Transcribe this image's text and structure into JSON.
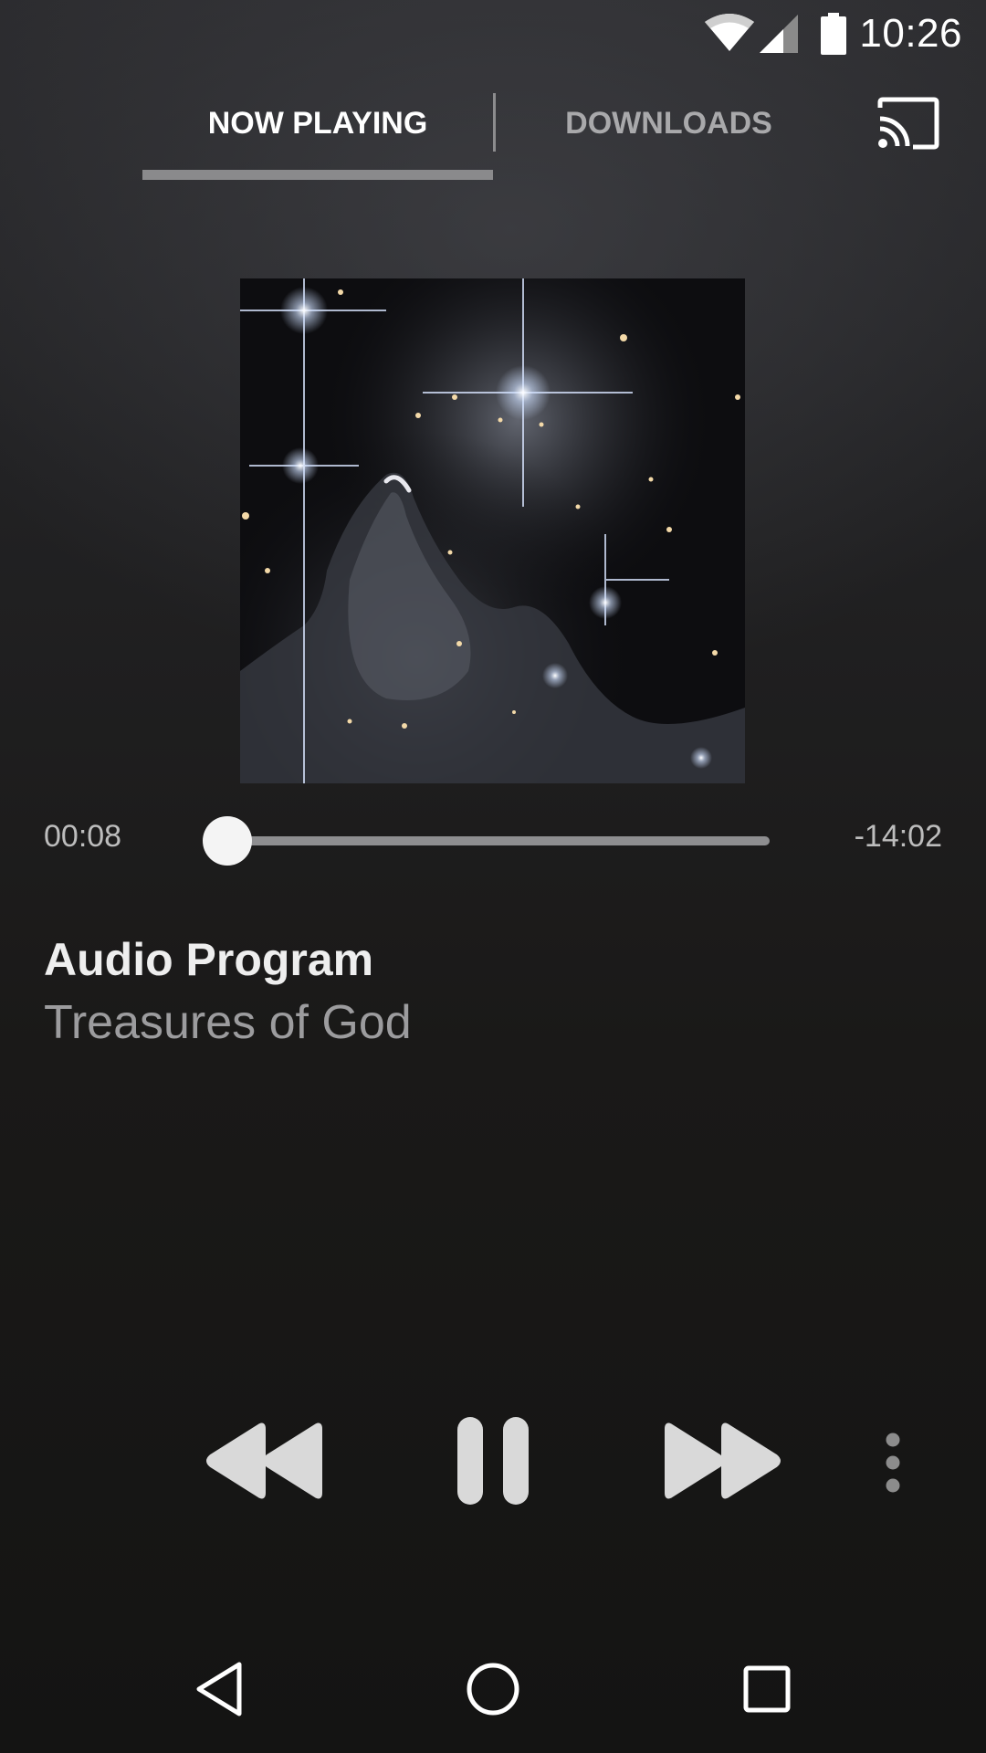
{
  "status_bar": {
    "time": "10:26",
    "icons": [
      "wifi-icon",
      "signal-icon",
      "battery-icon"
    ]
  },
  "tabs": [
    {
      "label": "NOW PLAYING",
      "active": true
    },
    {
      "label": "DOWNLOADS",
      "active": false
    }
  ],
  "header": {
    "cast_icon": "cast-icon"
  },
  "player": {
    "elapsed": "00:08",
    "remaining": "-14:02",
    "progress_fraction": 0.01,
    "title": "Audio Program",
    "subtitle": "Treasures of God"
  },
  "controls": {
    "icons": [
      "rewind-icon",
      "pause-icon",
      "fast-forward-icon",
      "more-vert-icon"
    ]
  },
  "nav_bar": {
    "icons": [
      "back-icon",
      "home-icon",
      "recents-icon"
    ]
  },
  "colors": {
    "background": "#1c1b1a",
    "tab_active": "#ffffff",
    "tab_inactive": "#a9a9ab",
    "tab_indicator": "#8a8a8c",
    "seek_track": "#8e8e90",
    "seek_thumb": "#f4f4f4",
    "controls": "#d9d9d9"
  }
}
